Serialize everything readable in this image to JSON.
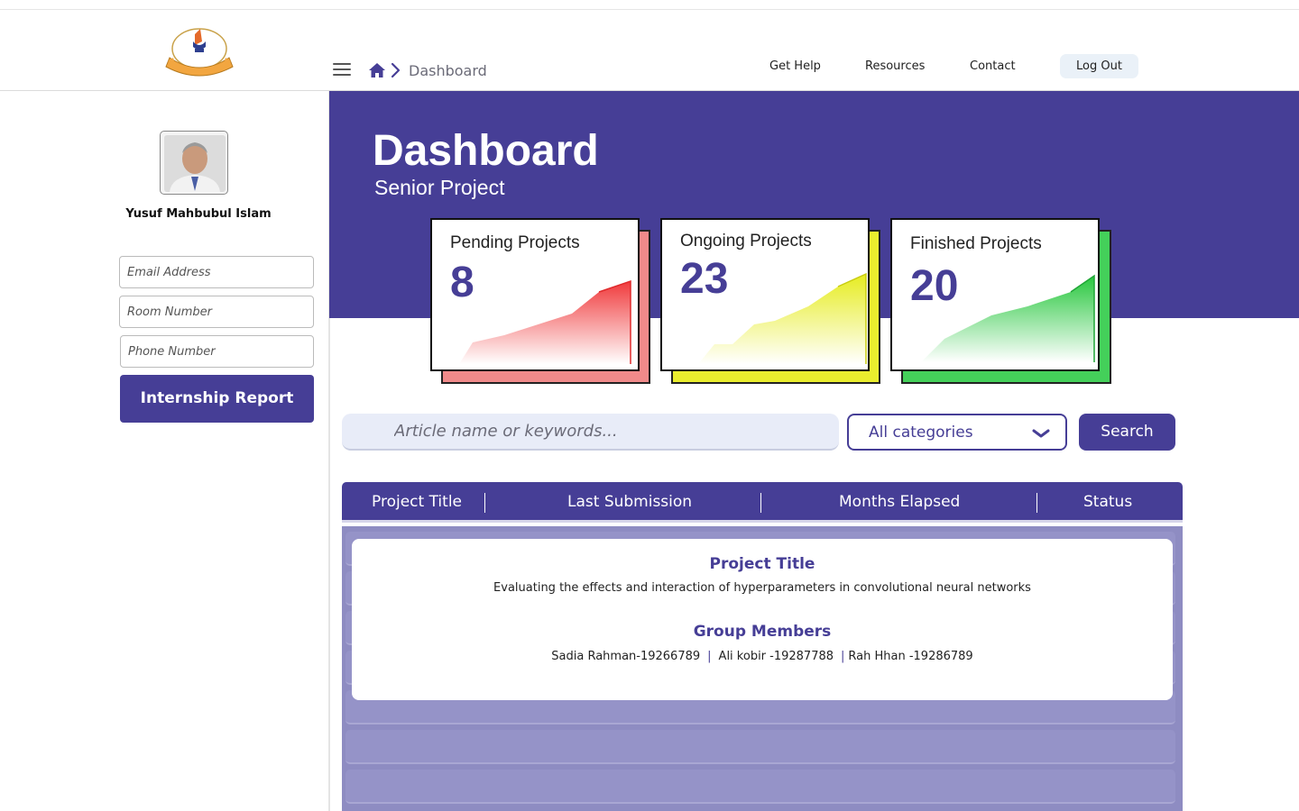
{
  "header": {
    "breadcrumb": {
      "current": "Dashboard"
    },
    "nav": [
      "Get Help",
      "Resources",
      "Contact"
    ],
    "logout_label": "Log Out"
  },
  "sidebar": {
    "user_name": "Yusuf Mahbubul Islam",
    "fields": {
      "email_placeholder": "Email Address",
      "room_placeholder": "Room Number",
      "phone_placeholder": "Phone Number"
    },
    "report_button": "Internship Report"
  },
  "banner": {
    "title": "Dashboard",
    "subtitle": "Senior  Project"
  },
  "stats": [
    {
      "label": "Pending Projects",
      "value": "8",
      "color": "#f0696b",
      "shadow": "#f08a8a"
    },
    {
      "label": "Ongoing Projects",
      "value": "23",
      "color": "#e8ec2a",
      "shadow": "#eaed2e"
    },
    {
      "label": "Finished Projects",
      "value": "20",
      "color": "#3ecf55",
      "shadow": "#44d05a"
    }
  ],
  "search": {
    "placeholder": "Article name or keywords...",
    "category": "All categories",
    "button": "Search"
  },
  "table": {
    "columns": [
      "Project Title",
      "Last  Submission",
      "Months Elapsed",
      "Status"
    ],
    "expanded": {
      "title_heading": "Project Title",
      "title": "Evaluating the effects and interaction of hyperparameters in convolutional neural networks",
      "members_heading": "Group Members",
      "members": [
        "Sadia Rahman-19266789",
        "Ali kobir -19287788",
        "Rah Hhan -19286789"
      ]
    }
  },
  "colors": {
    "brand": "#463e96",
    "table_body": "#8e8cc2"
  }
}
